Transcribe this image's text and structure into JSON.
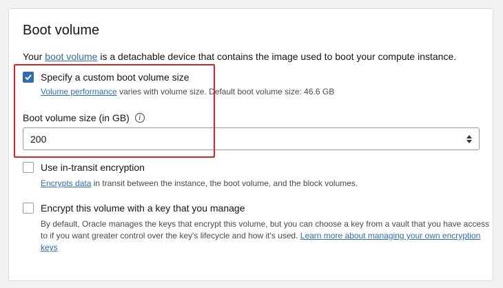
{
  "section": {
    "title": "Boot volume",
    "intro_prefix": "Your ",
    "intro_link": "boot volume",
    "intro_suffix": " is a detachable device that contains the image used to boot your compute instance."
  },
  "custom_size": {
    "label": "Specify a custom boot volume size",
    "checked": true,
    "help_link": "Volume performance",
    "help_text": " varies with volume size. Default boot volume size: 46.6 GB"
  },
  "size_field": {
    "label": "Boot volume size (in GB)",
    "info_glyph": "i",
    "value": "200"
  },
  "transit_encryption": {
    "label": "Use in-transit encryption",
    "checked": false,
    "help_link": "Encrypts data",
    "help_text": " in transit between the instance, the boot volume, and the block volumes."
  },
  "own_key": {
    "label": "Encrypt this volume with a key that you manage",
    "checked": false,
    "help_line1": "By default, Oracle manages the keys that encrypt this volume, but you can choose a key from a vault that you have access",
    "help_line2": "to if you want greater control over the key's lifecycle and how it's used. ",
    "help_link": "Learn more about managing your own encryption keys"
  },
  "colors": {
    "accent": "#2f6cb0",
    "highlight": "#e02020"
  },
  "icons": {
    "checkbox_checked": "check-icon",
    "info": "info-icon",
    "spinner": "spinner-icon"
  }
}
